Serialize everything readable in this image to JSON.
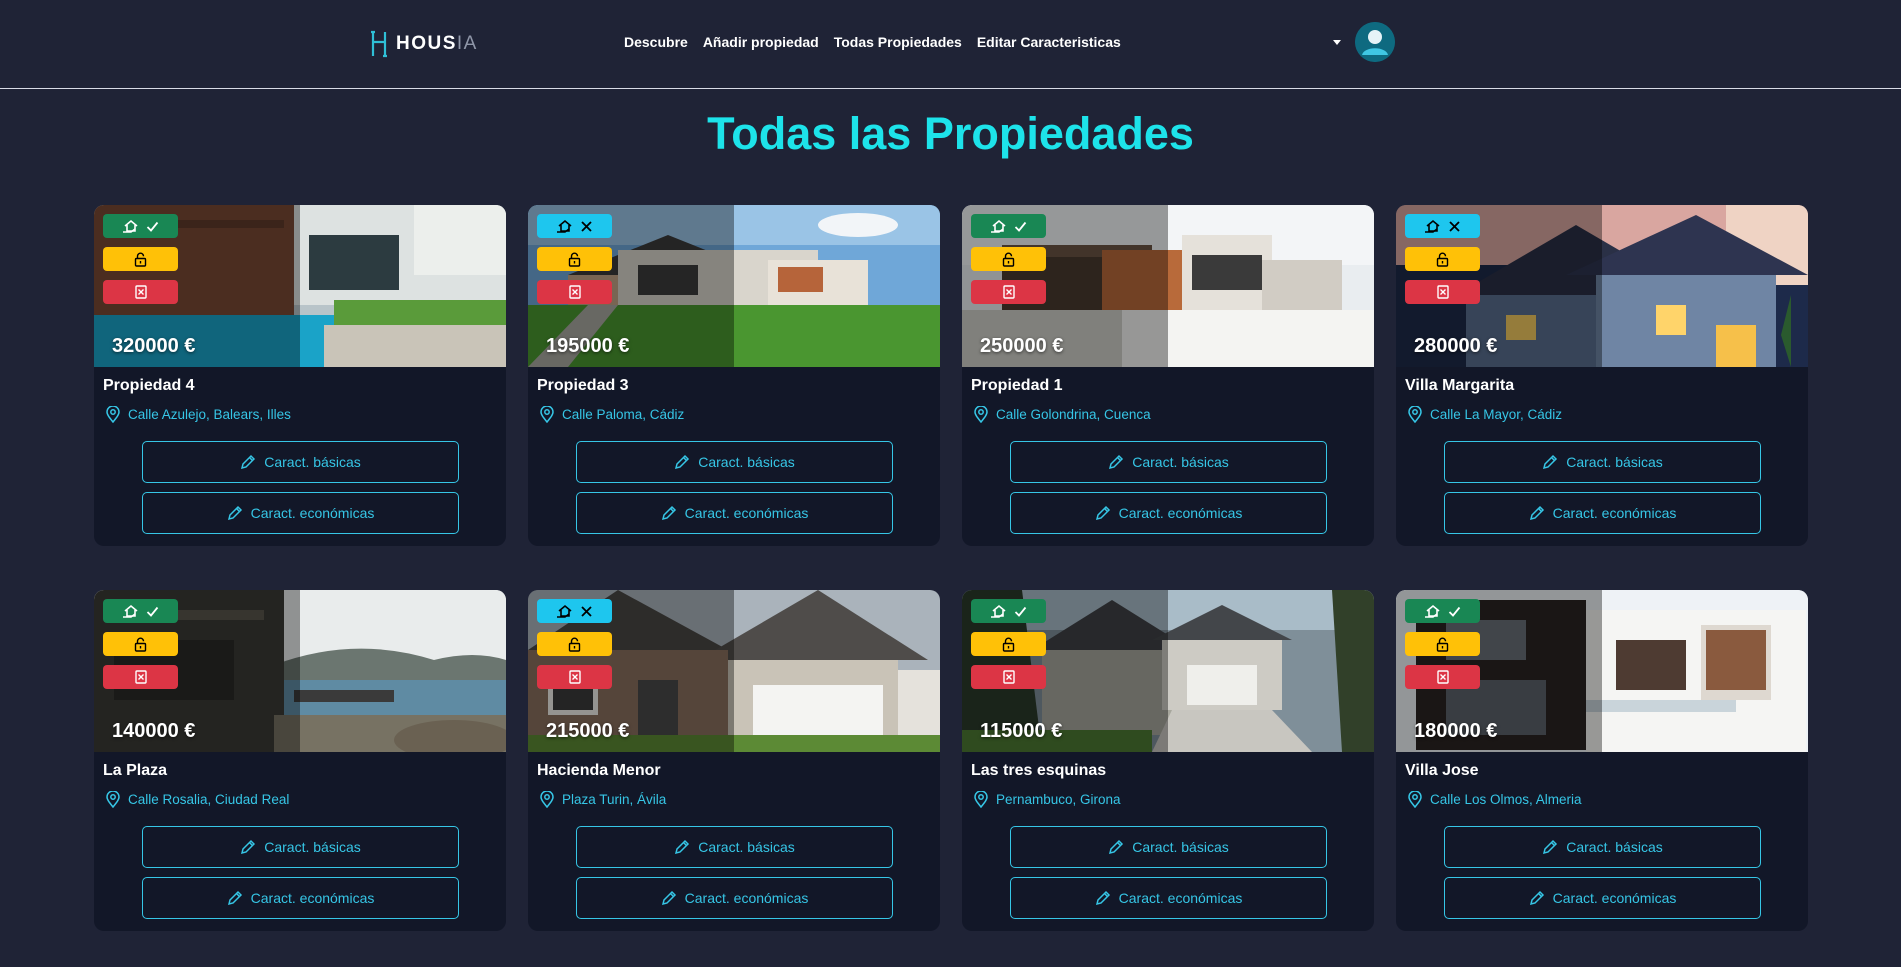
{
  "brand": {
    "logo_main": "HOUS",
    "logo_accent": "IA"
  },
  "nav": {
    "items": [
      "Descubre",
      "Añadir propiedad",
      "Todas Propiedades",
      "Editar Caracteristicas"
    ]
  },
  "page": {
    "title": "Todas las Propiedades"
  },
  "card_buttons": {
    "basic": "Caract. básicas",
    "economic": "Caract. económicas"
  },
  "colors": {
    "accent": "#1de3ea",
    "link": "#36c6e6",
    "available_badge": "#198754",
    "unavailable_badge": "#1ec6ee",
    "lock_badge": "#ffc107",
    "delete_badge": "#dc3545"
  },
  "properties": [
    {
      "name": "Propiedad 4",
      "price": "320000 €",
      "address": "Calle Azulejo, Balears, Illes",
      "status_icon": "check-icon",
      "status_color": "green",
      "scene": "pool"
    },
    {
      "name": "Propiedad 3",
      "price": "195000 €",
      "address": "Calle Paloma, Cádiz",
      "status_icon": "x-icon",
      "status_color": "cyan",
      "scene": "modern-lawn"
    },
    {
      "name": "Propiedad 1",
      "price": "250000 €",
      "address": "Calle Golondrina, Cuenca",
      "status_icon": "check-icon",
      "status_color": "green",
      "scene": "modern-white"
    },
    {
      "name": "Villa Margarita",
      "price": "280000 €",
      "address": "Calle La Mayor, Cádiz",
      "status_icon": "x-icon",
      "status_color": "cyan",
      "scene": "blue-house"
    },
    {
      "name": "La Plaza",
      "price": "140000 €",
      "address": "Calle Rosalia, Ciudad Real",
      "status_icon": "check-icon",
      "status_color": "green",
      "scene": "lake"
    },
    {
      "name": "Hacienda Menor",
      "price": "215000 €",
      "address": "Plaza Turin, Ávila",
      "status_icon": "x-icon",
      "status_color": "cyan",
      "scene": "garage-brick"
    },
    {
      "name": "Las tres esquinas",
      "price": "115000 €",
      "address": "Pernambuco, Girona",
      "status_icon": "check-icon",
      "status_color": "green",
      "scene": "gray-house"
    },
    {
      "name": "Villa Jose",
      "price": "180000 €",
      "address": "Calle Los Olmos, Almeria",
      "status_icon": "check-icon",
      "status_color": "green",
      "scene": "white-modern"
    }
  ]
}
